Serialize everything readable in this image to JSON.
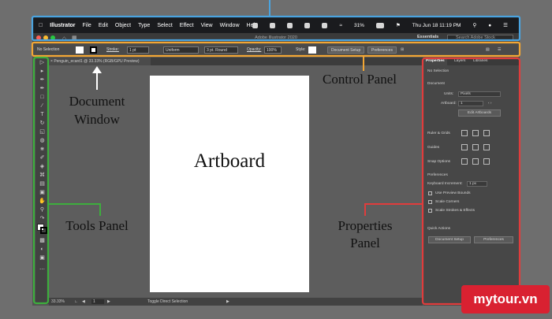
{
  "menubar": {
    "app": "Illustrator",
    "items": [
      "File",
      "Edit",
      "Object",
      "Type",
      "Select",
      "Effect",
      "View",
      "Window",
      "Help"
    ],
    "battery": "31%",
    "datetime": "Thu Jun 18  11:19 PM"
  },
  "titlebar": {
    "title": "Adobe Illustrator 2020",
    "workspace": "Essentials",
    "search_placeholder": "Search Adobe Stock"
  },
  "control_panel": {
    "selection": "No Selection",
    "stroke_label": "Stroke:",
    "stroke_value": "1 pt",
    "profile": "Uniform",
    "brush": "3 pt. Round",
    "opacity_label": "Opacity:",
    "opacity_value": "100%",
    "style_label": "Style:",
    "document_setup": "Document Setup",
    "preferences": "Preferences"
  },
  "document_tab": {
    "label": "Penguin_ecard1 @ 33.33% (RGB/GPU Preview)"
  },
  "artboard": {
    "label": "Artboard"
  },
  "statusbar": {
    "zoom": "33.33%",
    "artboard_num": "1",
    "tool": "Toggle Direct Selection"
  },
  "properties": {
    "tabs": [
      "Properties",
      "Layers",
      "Libraries"
    ],
    "no_selection": "No Selection",
    "document_heading": "Document",
    "units_label": "Units:",
    "units_value": "Pixels",
    "artboard_label": "Artboard:",
    "artboard_value": "1",
    "edit_artboards": "Edit Artboards",
    "ruler_grids": "Ruler & Grids",
    "guides": "Guides",
    "snap_options": "Snap Options",
    "preferences_heading": "Preferences",
    "keyboard_increment_label": "Keyboard Increment:",
    "keyboard_increment_value": "1 px",
    "use_preview_bounds": "Use Preview Bounds",
    "scale_corners": "Scale Corners",
    "scale_strokes": "Scale Strokes & Effects",
    "quick_actions": "Quick Actions",
    "document_setup": "Document Setup",
    "preferences_btn": "Preferences"
  },
  "annotations": {
    "control_panel": "Control Panel",
    "document_window_line1": "Document",
    "document_window_line2": "Window",
    "tools_panel": "Tools Panel",
    "properties_line1": "Properties",
    "properties_line2": "Panel"
  },
  "watermark": "mytour.vn",
  "colors": {
    "blue_outline": "#4aa3df",
    "orange_outline": "#f2a634",
    "green_outline": "#3dae3d",
    "red_outline": "#e03c3c",
    "watermark_bg": "#d92131"
  }
}
